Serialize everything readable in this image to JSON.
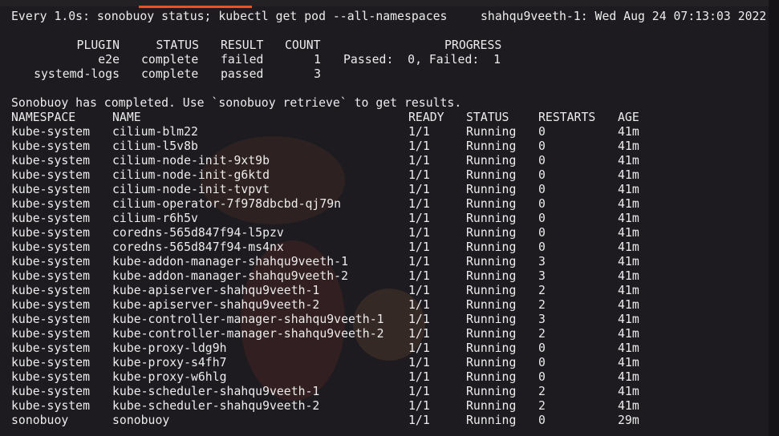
{
  "header": {
    "command": "Every 1.0s: sonobuoy status; kubectl get pod --all-namespaces",
    "host_time": "shahqu9veeth-1: Wed Aug 24 07:13:03 2022"
  },
  "sonobuoy": {
    "headers": [
      "PLUGIN",
      "STATUS",
      "RESULT",
      "COUNT",
      "PROGRESS"
    ],
    "rows": [
      {
        "plugin": "e2e",
        "status": "complete",
        "result": "failed",
        "count": "1",
        "progress": "Passed:  0, Failed:  1"
      },
      {
        "plugin": "systemd-logs",
        "status": "complete",
        "result": "passed",
        "count": "3",
        "progress": ""
      }
    ],
    "message": "Sonobuoy has completed. Use `sonobuoy retrieve` to get results."
  },
  "pods": {
    "headers": [
      "NAMESPACE",
      "NAME",
      "READY",
      "STATUS",
      "RESTARTS",
      "AGE"
    ],
    "rows": [
      [
        "kube-system",
        "cilium-blm22",
        "1/1",
        "Running",
        "0",
        "41m"
      ],
      [
        "kube-system",
        "cilium-l5v8b",
        "1/1",
        "Running",
        "0",
        "41m"
      ],
      [
        "kube-system",
        "cilium-node-init-9xt9b",
        "1/1",
        "Running",
        "0",
        "41m"
      ],
      [
        "kube-system",
        "cilium-node-init-g6ktd",
        "1/1",
        "Running",
        "0",
        "41m"
      ],
      [
        "kube-system",
        "cilium-node-init-tvpvt",
        "1/1",
        "Running",
        "0",
        "41m"
      ],
      [
        "kube-system",
        "cilium-operator-7f978dbcbd-qj79n",
        "1/1",
        "Running",
        "0",
        "41m"
      ],
      [
        "kube-system",
        "cilium-r6h5v",
        "1/1",
        "Running",
        "0",
        "41m"
      ],
      [
        "kube-system",
        "coredns-565d847f94-l5pzv",
        "1/1",
        "Running",
        "0",
        "41m"
      ],
      [
        "kube-system",
        "coredns-565d847f94-ms4nx",
        "1/1",
        "Running",
        "0",
        "41m"
      ],
      [
        "kube-system",
        "kube-addon-manager-shahqu9veeth-1",
        "1/1",
        "Running",
        "3",
        "41m"
      ],
      [
        "kube-system",
        "kube-addon-manager-shahqu9veeth-2",
        "1/1",
        "Running",
        "3",
        "41m"
      ],
      [
        "kube-system",
        "kube-apiserver-shahqu9veeth-1",
        "1/1",
        "Running",
        "2",
        "41m"
      ],
      [
        "kube-system",
        "kube-apiserver-shahqu9veeth-2",
        "1/1",
        "Running",
        "2",
        "41m"
      ],
      [
        "kube-system",
        "kube-controller-manager-shahqu9veeth-1",
        "1/1",
        "Running",
        "3",
        "41m"
      ],
      [
        "kube-system",
        "kube-controller-manager-shahqu9veeth-2",
        "1/1",
        "Running",
        "2",
        "41m"
      ],
      [
        "kube-system",
        "kube-proxy-ldg9h",
        "1/1",
        "Running",
        "0",
        "41m"
      ],
      [
        "kube-system",
        "kube-proxy-s4fh7",
        "1/1",
        "Running",
        "0",
        "41m"
      ],
      [
        "kube-system",
        "kube-proxy-w6hlg",
        "1/1",
        "Running",
        "0",
        "41m"
      ],
      [
        "kube-system",
        "kube-scheduler-shahqu9veeth-1",
        "1/1",
        "Running",
        "2",
        "41m"
      ],
      [
        "kube-system",
        "kube-scheduler-shahqu9veeth-2",
        "1/1",
        "Running",
        "2",
        "41m"
      ],
      [
        "sonobuoy",
        "sonobuoy",
        "1/1",
        "Running",
        "0",
        "29m"
      ]
    ]
  },
  "colors": {
    "background": "#1d1b1f",
    "text": "#ececec",
    "accent": "#e95420"
  }
}
